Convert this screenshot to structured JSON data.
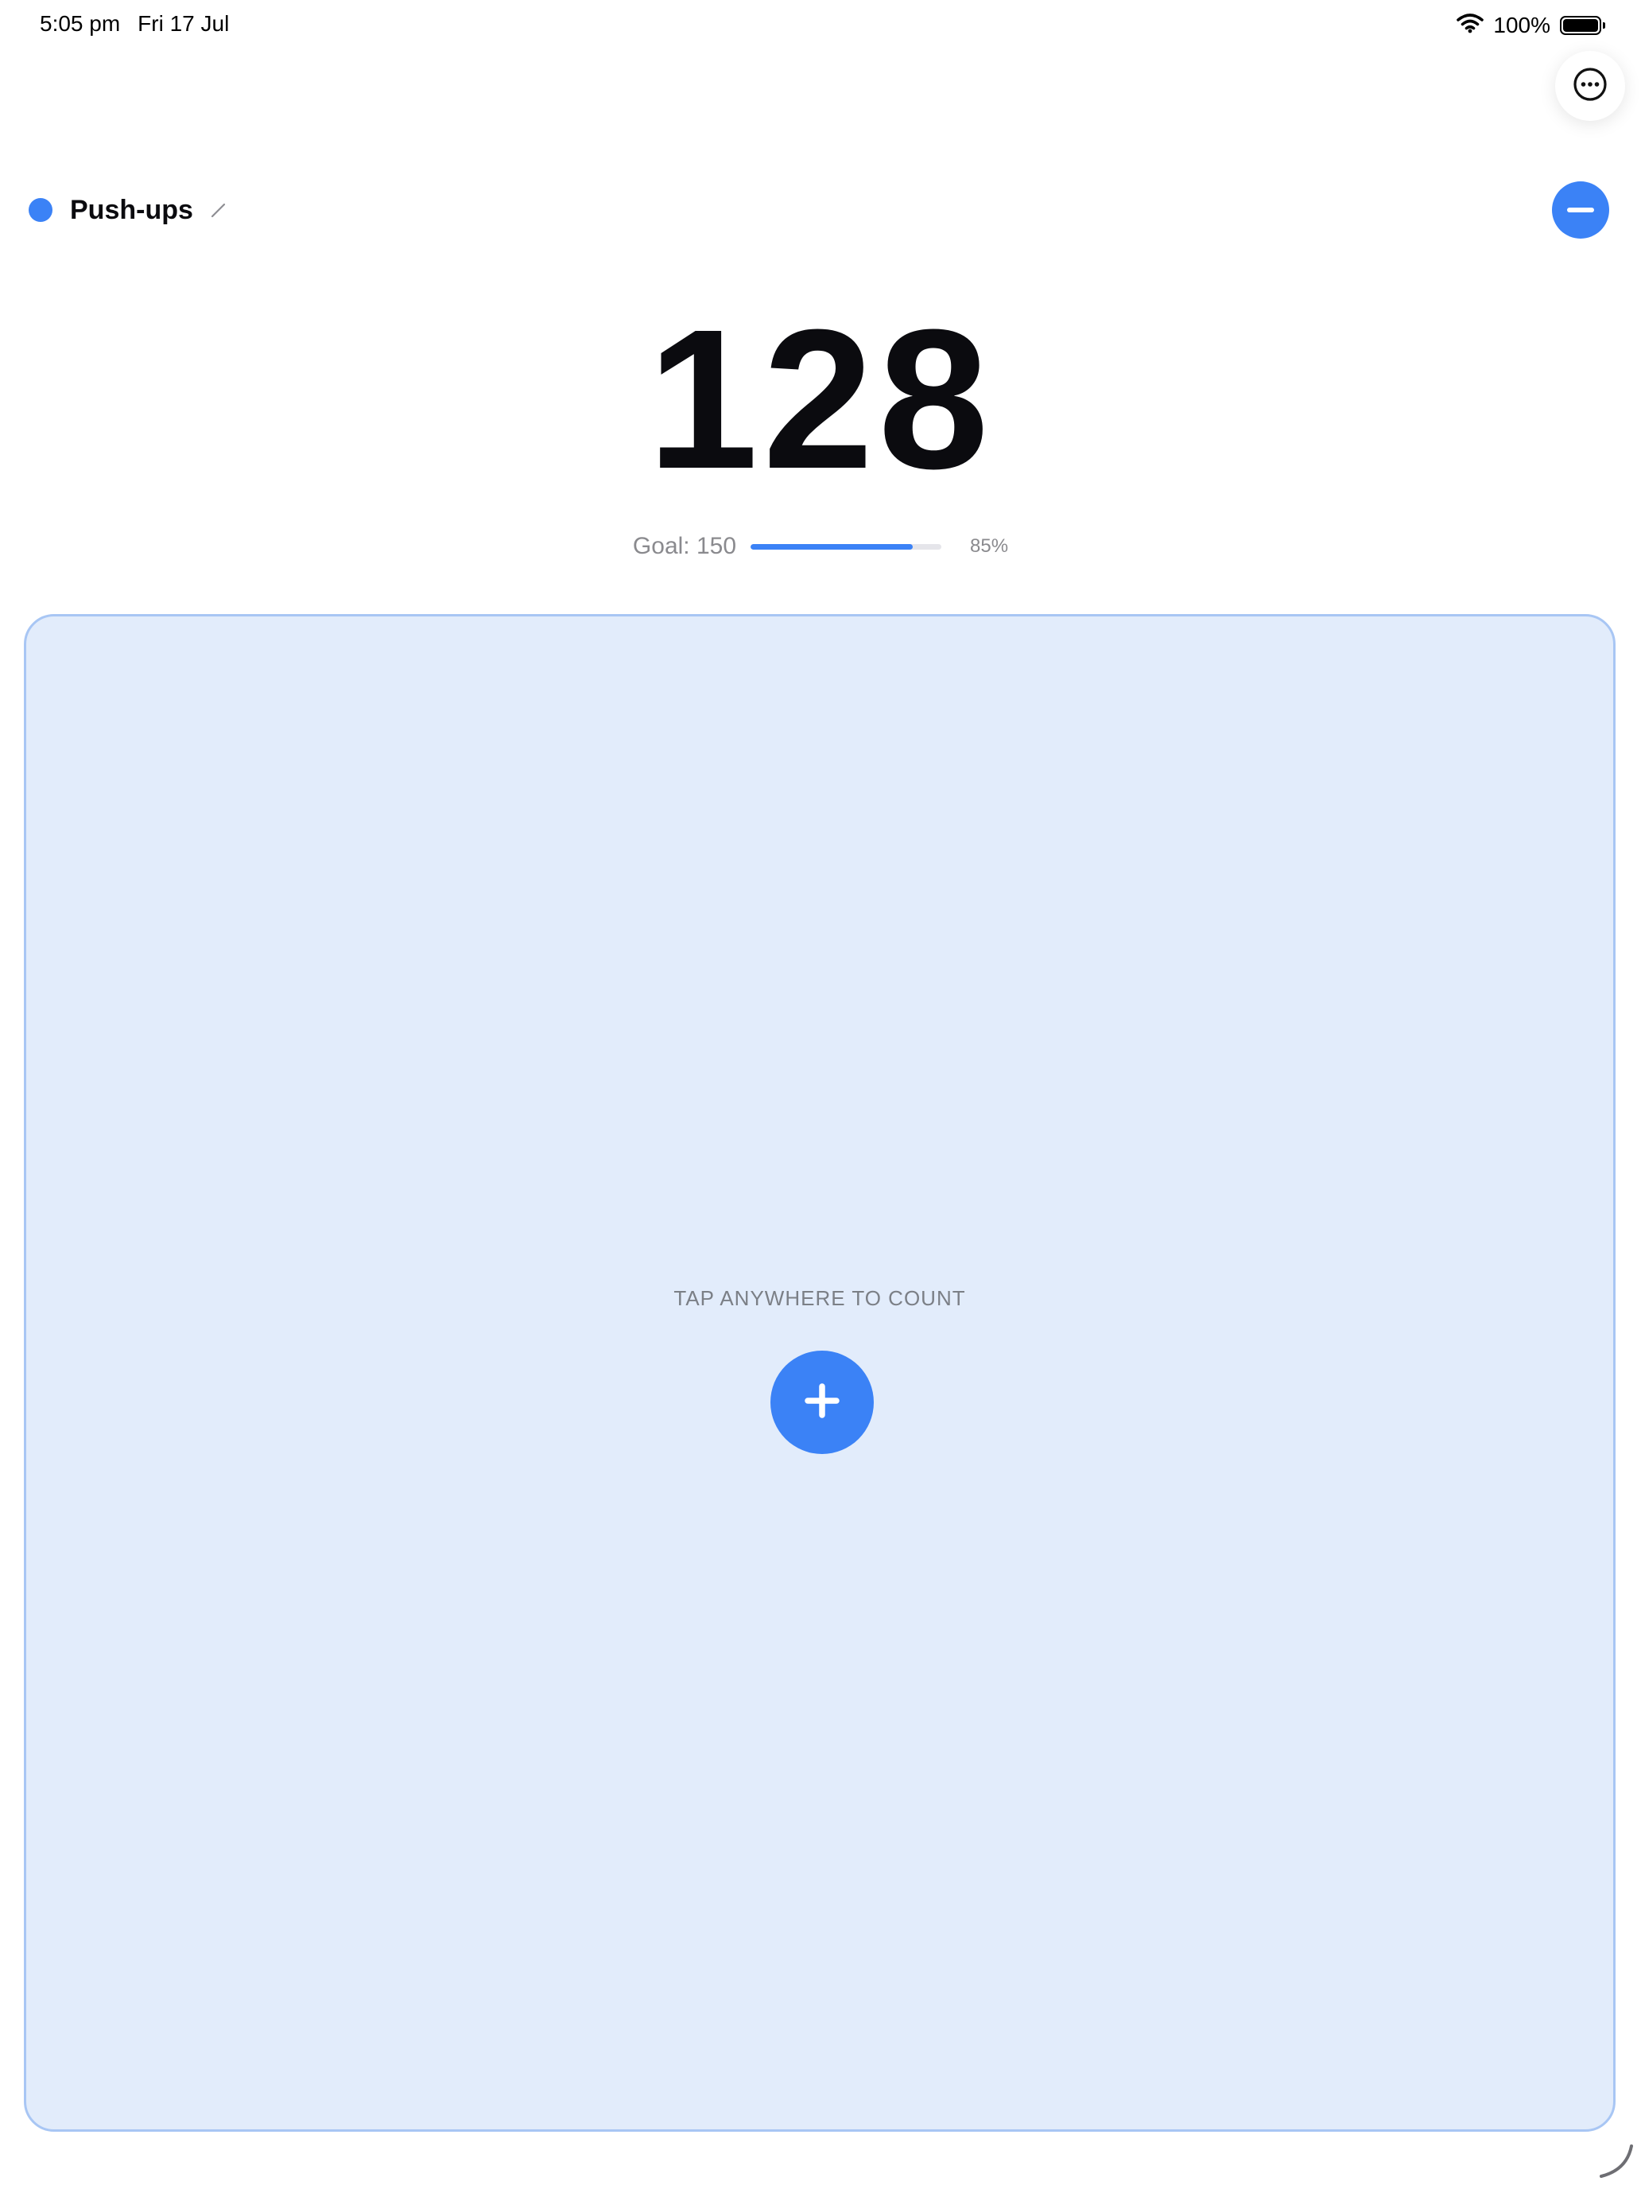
{
  "status_bar": {
    "time": "5:05 pm",
    "date": "Fri 17 Jul",
    "battery_text": "100%"
  },
  "header": {
    "counter_name": "Push-ups",
    "accent_color": "#3b82f6"
  },
  "counter": {
    "value": "128",
    "goal_label": "Goal: 150",
    "progress_fraction": 0.85,
    "progress_text": "85%"
  },
  "tap_area": {
    "hint": "TAP ANYWHERE TO COUNT",
    "background_color": "#e2ecfb",
    "border_color": "#a8c6f4"
  },
  "icons": {
    "more": "ellipsis-circle-icon",
    "edit": "pencil-icon",
    "decrement": "minus-icon",
    "increment": "plus-icon",
    "wifi": "wifi-icon",
    "battery": "battery-icon"
  }
}
